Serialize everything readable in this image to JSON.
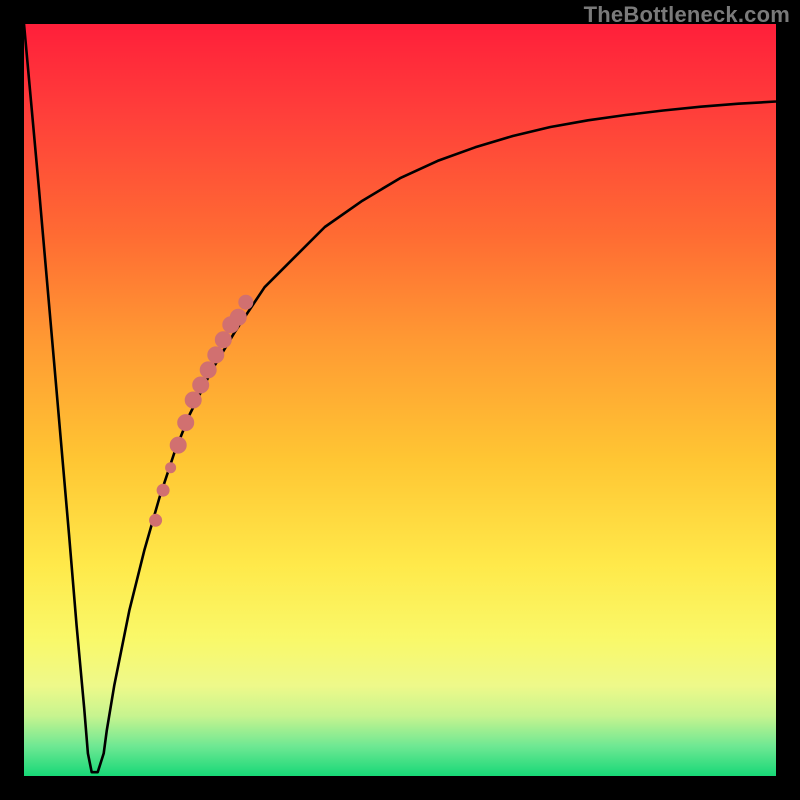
{
  "watermark": "TheBottleneck.com",
  "colors": {
    "curve": "#000000",
    "marker_fill": "#d17070",
    "marker_stroke": "#d17070"
  },
  "chart_data": {
    "type": "line",
    "title": "",
    "xlabel": "",
    "ylabel": "",
    "xlim": [
      0,
      100
    ],
    "ylim": [
      0,
      100
    ],
    "grid": false,
    "notes": "Background is a vertical bottleneck-percentage heat gradient (red = high %, green = 0%). The black curve is the absolute bottleneck percentage as a function of x; it drops from 100% to ~0% near x≈9 then rises asymptotically toward ~90%. Salmon markers highlight a dense cluster of sampled hardware points along the rising branch between roughly x=17 and x=30.",
    "series": [
      {
        "name": "bottleneck_pct",
        "x": [
          0,
          2,
          4,
          6,
          7,
          8,
          8.5,
          9,
          9.8,
          10.6,
          11,
          12,
          14,
          16,
          18,
          20,
          22,
          25,
          28,
          32,
          36,
          40,
          45,
          50,
          55,
          60,
          65,
          70,
          75,
          80,
          85,
          90,
          95,
          100
        ],
        "y": [
          100,
          78,
          55,
          32,
          20,
          9,
          3,
          0.5,
          0.5,
          3,
          6,
          12,
          22,
          30,
          37,
          43,
          48,
          54,
          59,
          65,
          69,
          73,
          76.5,
          79.5,
          81.8,
          83.6,
          85.1,
          86.3,
          87.2,
          87.9,
          88.5,
          89,
          89.4,
          89.7
        ]
      }
    ],
    "markers": [
      {
        "x": 17.5,
        "y": 34,
        "r": 6
      },
      {
        "x": 18.5,
        "y": 38,
        "r": 6
      },
      {
        "x": 19.5,
        "y": 41,
        "r": 5
      },
      {
        "x": 20.5,
        "y": 44,
        "r": 8
      },
      {
        "x": 21.5,
        "y": 47,
        "r": 8
      },
      {
        "x": 22.5,
        "y": 50,
        "r": 8
      },
      {
        "x": 23.5,
        "y": 52,
        "r": 8
      },
      {
        "x": 24.5,
        "y": 54,
        "r": 8
      },
      {
        "x": 25.5,
        "y": 56,
        "r": 8
      },
      {
        "x": 26.5,
        "y": 58,
        "r": 8
      },
      {
        "x": 27.5,
        "y": 60,
        "r": 8
      },
      {
        "x": 28.5,
        "y": 61,
        "r": 8
      },
      {
        "x": 29.5,
        "y": 63,
        "r": 7
      }
    ]
  }
}
